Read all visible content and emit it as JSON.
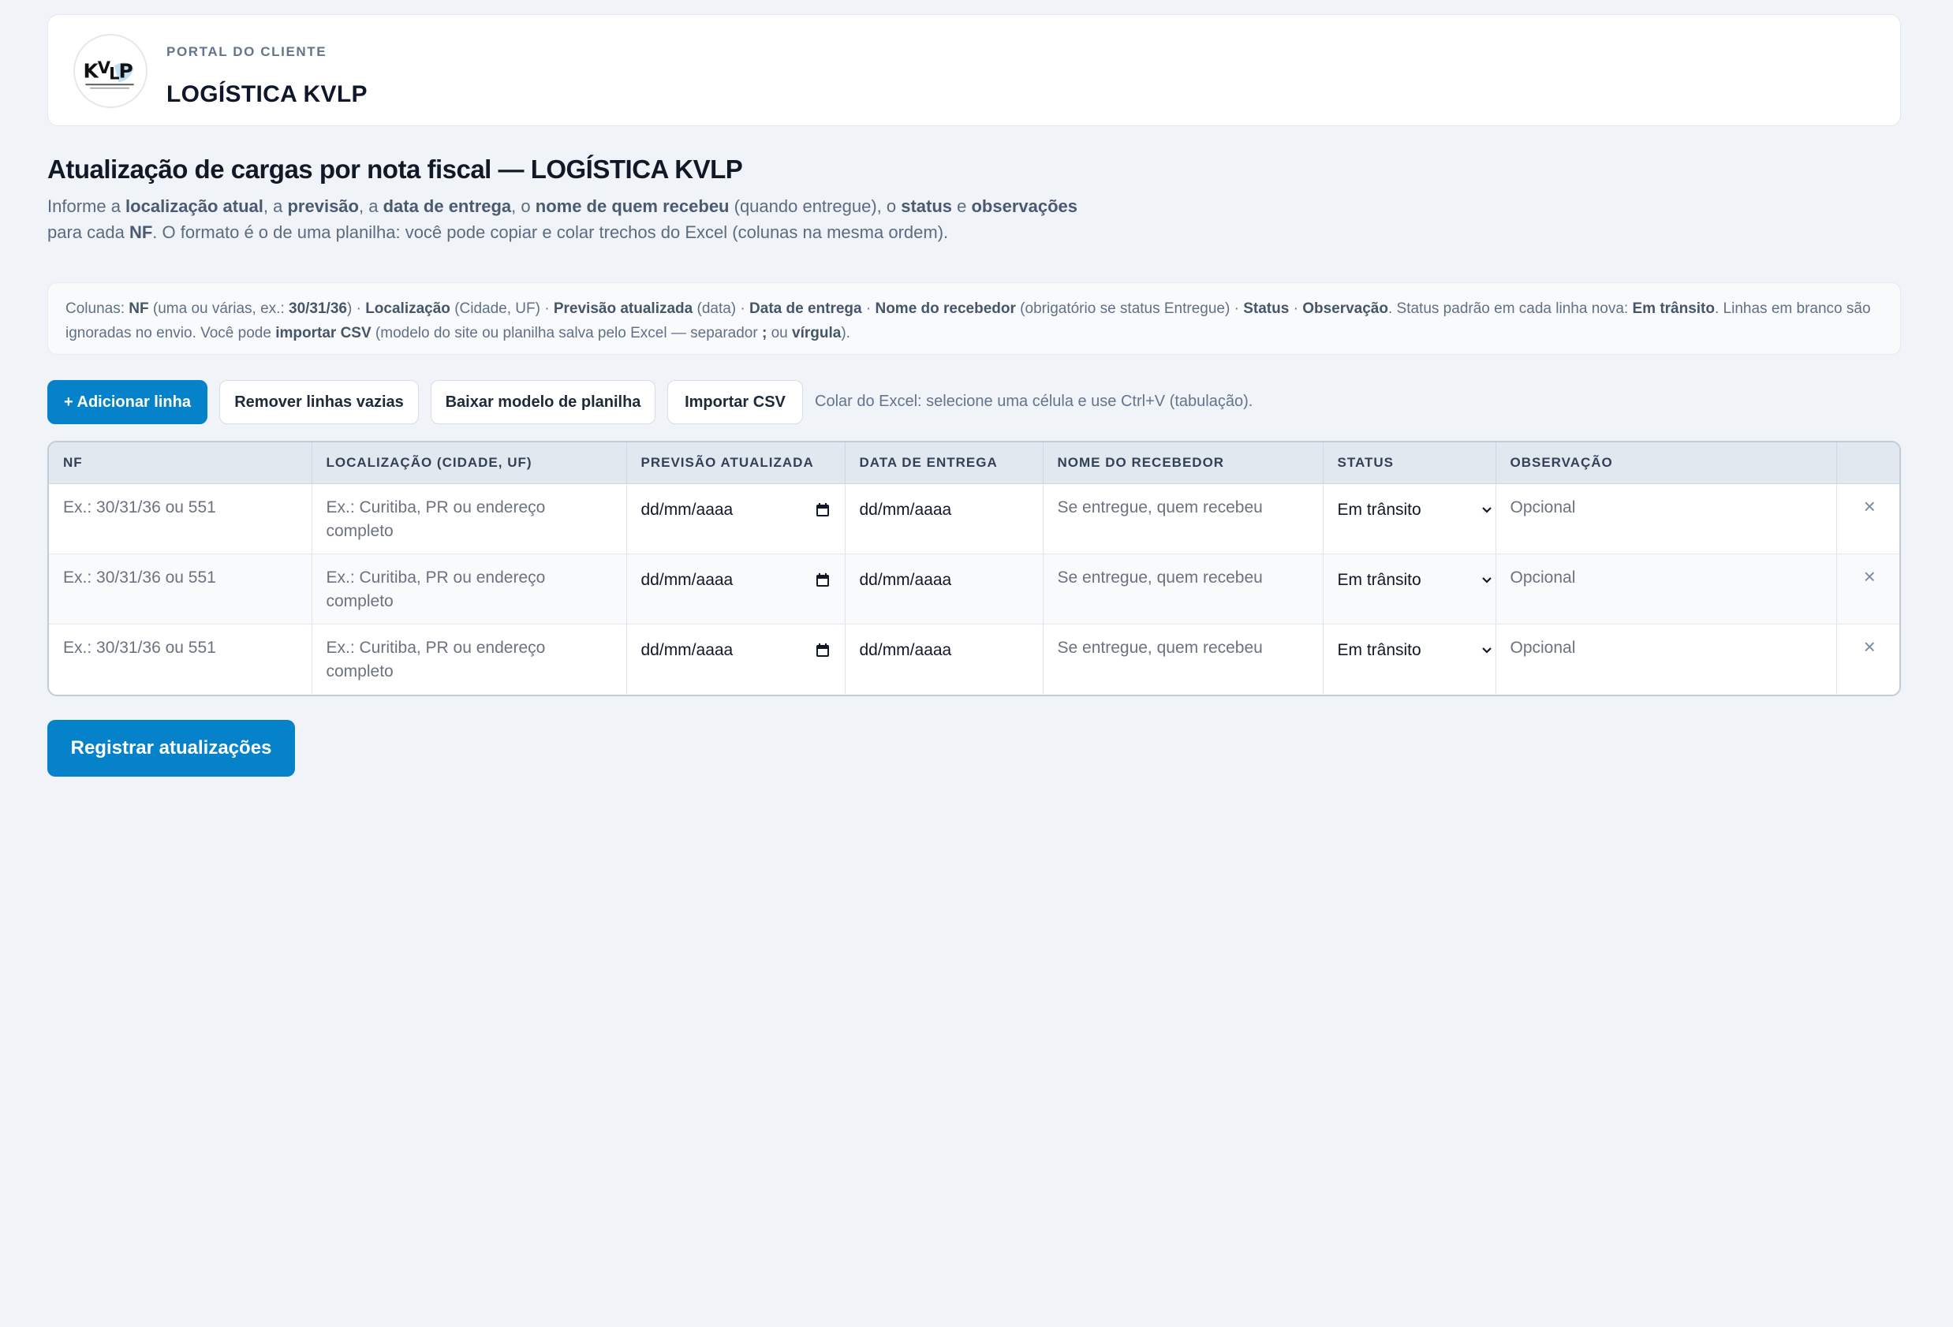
{
  "header": {
    "portal_label": "PORTAL DO CLIENTE",
    "brand": "LOGÍSTICA KVLP",
    "logo_text": "KVLP"
  },
  "page": {
    "title": "Atualização de cargas por nota fiscal — LOGÍSTICA KVLP",
    "intro": {
      "p1": "Informe a ",
      "b1": "localização atual",
      "p2": ", a ",
      "b2": "previsão",
      "p3": ", a ",
      "b3": "data de entrega",
      "p4": ", o ",
      "b4": "nome de quem recebeu",
      "p5": " (quando entregue), o ",
      "b5": "status",
      "p6": " e ",
      "b6": "observações",
      "p7": " para cada ",
      "b7": "NF",
      "p8": ". O formato é o de uma planilha: você pode copiar e colar trechos do Excel (colunas na mesma ordem)."
    },
    "columns_note": {
      "t1": "Colunas: ",
      "b1": "NF",
      "t2": " (uma ou várias, ex.: ",
      "b2": "30/31/36",
      "t3": ") · ",
      "b3": "Localização",
      "t4": " (Cidade, UF) · ",
      "b4": "Previsão atualizada",
      "t5": " (data) · ",
      "b5": "Data de entrega",
      "t6": " · ",
      "b6": "Nome do recebedor",
      "t7": " (obrigatório se status Entregue) · ",
      "b7": "Status",
      "t8": " · ",
      "b8": "Observação",
      "t9": ". Status padrão em cada linha nova: ",
      "b9": "Em trânsito",
      "t10": ". Linhas em branco são ignoradas no envio. Você pode ",
      "b10": "importar CSV",
      "t11": " (modelo do site ou planilha salva pelo Excel — separador ",
      "b11": ";",
      "t12": " ou ",
      "b12": "vírgula",
      "t13": ")."
    }
  },
  "toolbar": {
    "add_row": "+ Adicionar linha",
    "remove_empty": "Remover linhas vazias",
    "download_template": "Baixar modelo de planilha",
    "import_csv": "Importar CSV",
    "paste_hint": "Colar do Excel: selecione uma célula e use Ctrl+V (tabulação)."
  },
  "table": {
    "headers": {
      "nf": "NF",
      "location": "LOCALIZAÇÃO (CIDADE, UF)",
      "forecast": "PREVISÃO ATUALIZADA",
      "delivery": "DATA DE ENTREGA",
      "receiver": "NOME DO RECEBEDOR",
      "status": "STATUS",
      "observation": "OBSERVAÇÃO"
    },
    "placeholders": {
      "nf": "Ex.: 30/31/36 ou 551",
      "location": "Ex.: Curitiba, PR ou endereço completo",
      "date": "dd/mm/aaaa",
      "receiver": "Se entregue, quem recebeu",
      "observation": "Opcional"
    },
    "rows": [
      {
        "status": "Em trânsito",
        "remove": "×"
      },
      {
        "status": "Em trânsito",
        "remove": "×"
      },
      {
        "status": "Em trânsito",
        "remove": "×"
      }
    ]
  },
  "submit": {
    "label": "Registrar atualizações"
  },
  "colors": {
    "primary": "#0582c9",
    "background": "#f0f3f7",
    "header_row": "#e2e8f0"
  }
}
